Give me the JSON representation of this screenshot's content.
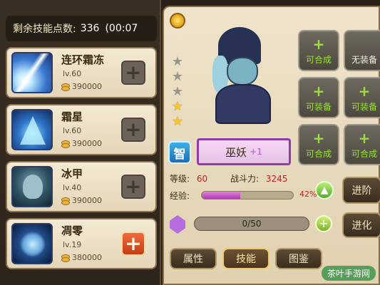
{
  "header": {
    "skill_points_label": "剩余技能点数:",
    "skill_points_value": "336",
    "timer": "(00:07"
  },
  "skills": [
    {
      "name": "连环霜冻",
      "level": "lv.60",
      "cost": "390000",
      "icon": "frost-chain-icon",
      "upgrade_state": "disabled"
    },
    {
      "name": "霜星",
      "level": "lv.60",
      "cost": "390000",
      "icon": "frost-star-icon",
      "upgrade_state": "disabled"
    },
    {
      "name": "冰甲",
      "level": "lv.40",
      "cost": "390000",
      "icon": "ice-armor-icon",
      "upgrade_state": "disabled"
    },
    {
      "name": "凋零",
      "level": "lv.19",
      "cost": "380000",
      "icon": "wither-icon",
      "upgrade_state": "available"
    }
  ],
  "hero": {
    "attribute": "智",
    "name": "巫妖",
    "plus": "+1",
    "stars_lit": 2,
    "stars_total": 5,
    "level_label": "等级:",
    "level_value": "60",
    "power_label": "战斗力:",
    "power_value": "3245",
    "exp_label": "经验:",
    "exp_percent": "42%",
    "exp_fraction": 0.42,
    "stone_count": "0/50"
  },
  "equipment": [
    {
      "status": "可合成",
      "plus": "+",
      "color": "green"
    },
    {
      "status": "无装备",
      "plus": "",
      "color": "white"
    },
    {
      "status": "可装备",
      "plus": "+",
      "color": "green"
    },
    {
      "status": "可装备",
      "plus": "+",
      "color": "green"
    },
    {
      "status": "可合成",
      "plus": "+",
      "color": "green"
    },
    {
      "status": "可合成",
      "plus": "+",
      "color": "green"
    }
  ],
  "buttons": {
    "advance": "进阶",
    "evolve": "进化",
    "plus": "+"
  },
  "tabs": [
    {
      "label": "属性",
      "active": false
    },
    {
      "label": "技能",
      "active": true
    },
    {
      "label": "图鉴",
      "active": false
    }
  ],
  "watermark": "茶叶手游网",
  "colors": {
    "panel_bg": "#efe4cb",
    "frame_gold": "#8a6f44",
    "name_plate_border": "#8e3bb0",
    "exp_fill": "#b03bb0",
    "green_status": "#9be03a",
    "red_number": "#c82020"
  }
}
